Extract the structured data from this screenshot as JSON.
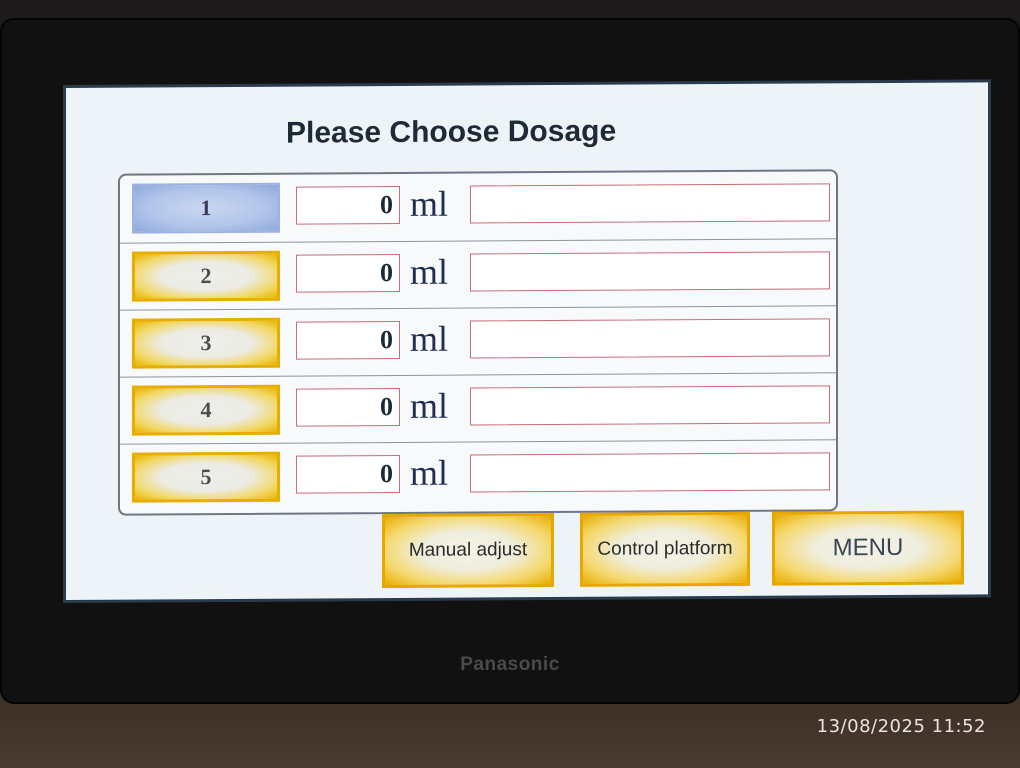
{
  "screen": {
    "title": "Please Choose Dosage",
    "rows": [
      {
        "number": "1",
        "value": "0",
        "unit": "ml",
        "selected": true
      },
      {
        "number": "2",
        "value": "0",
        "unit": "ml",
        "selected": false
      },
      {
        "number": "3",
        "value": "0",
        "unit": "ml",
        "selected": false
      },
      {
        "number": "4",
        "value": "0",
        "unit": "ml",
        "selected": false
      },
      {
        "number": "5",
        "value": "0",
        "unit": "ml",
        "selected": false
      }
    ],
    "buttons": {
      "manual_adjust": "Manual adjust",
      "control_platform": "Control platform",
      "menu": "MENU"
    }
  },
  "bezel": {
    "brand": "Panasonic"
  },
  "photo_timestamp": "13/08/2025 11:52",
  "colors": {
    "screen_bg": "#eef3f8",
    "button_gold": "#e8b400",
    "selected_blue": "#b3c6ea",
    "field_border": "#c76c78"
  }
}
